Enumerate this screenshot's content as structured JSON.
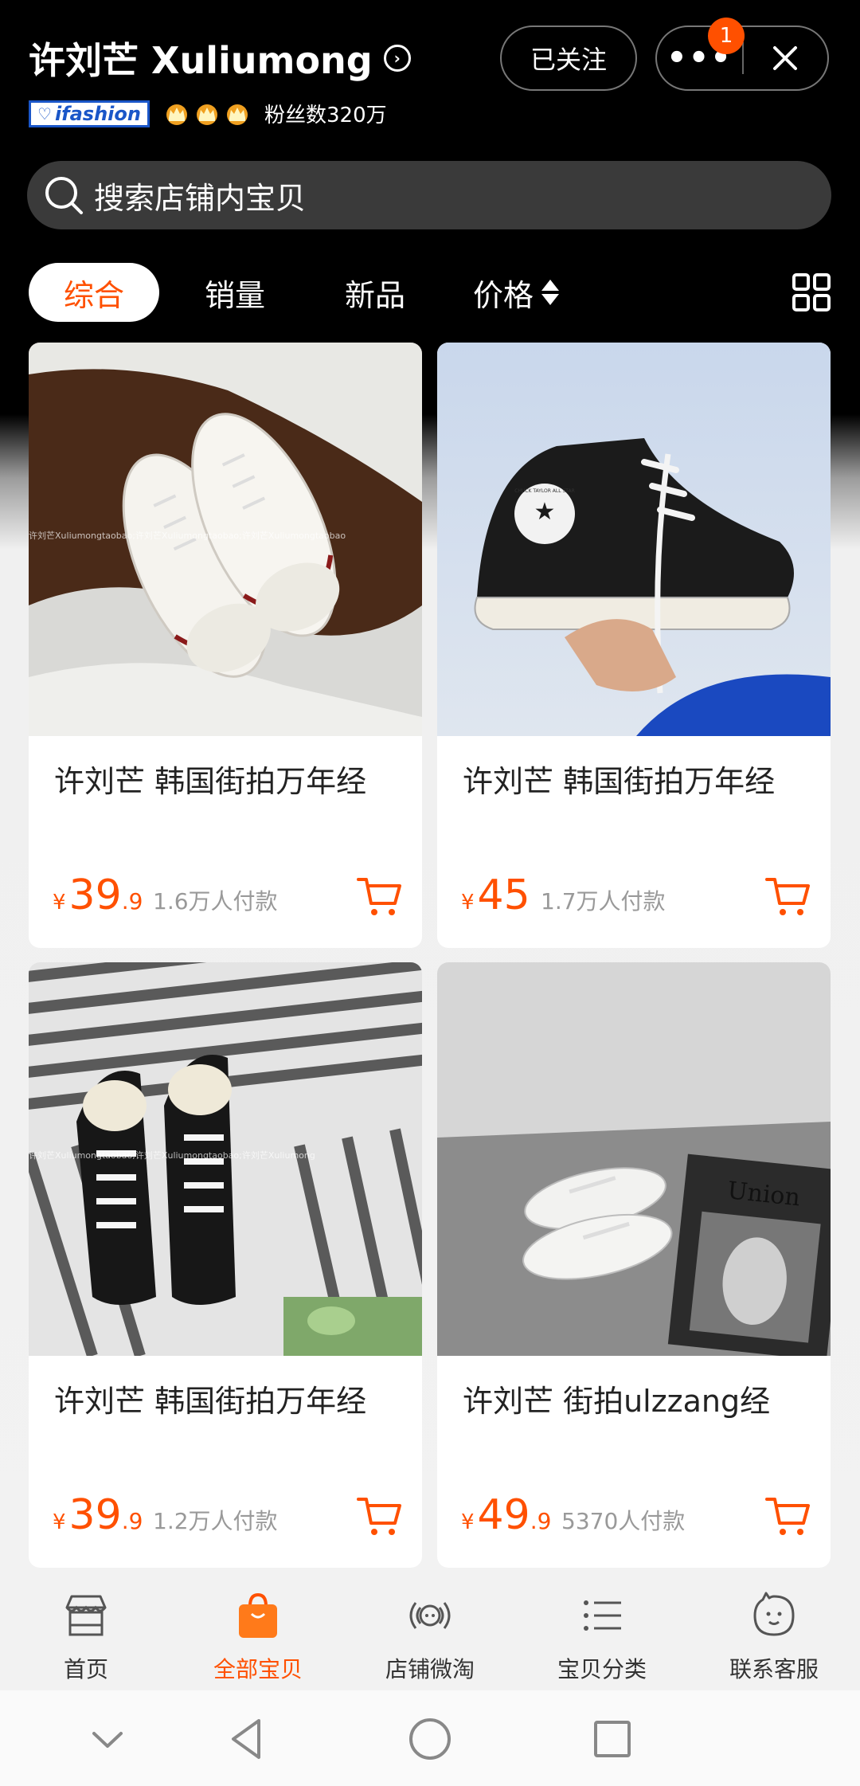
{
  "header": {
    "store_name": "许刘芒 Xuliumong",
    "info_symbol": "›",
    "brand_badge": "ifashion",
    "fans": "粉丝数320万",
    "follow_label": "已关注",
    "notification_count": "1",
    "more_glyph": "•••"
  },
  "search": {
    "placeholder": "搜索店铺内宝贝"
  },
  "tabs": [
    {
      "label": "综合"
    },
    {
      "label": "销量"
    },
    {
      "label": "新品"
    },
    {
      "label": "价格"
    }
  ],
  "products": [
    {
      "title": "许刘芒 韩国街拍万年经",
      "yen": "¥",
      "price_int": "39",
      "price_dec": ".9",
      "sold": "1.6万人付款",
      "watermark": "许刘芒Xuliumongtaobao;许刘芒Xuliumongtaobao;许刘芒Xuliumongtaobao"
    },
    {
      "title": "许刘芒 韩国街拍万年经",
      "yen": "¥",
      "price_int": "45",
      "price_dec": "",
      "sold": "1.7万人付款",
      "shoe_text": "CHUCK TAYLOR ALL STAR"
    },
    {
      "title": "许刘芒 韩国街拍万年经",
      "yen": "¥",
      "price_int": "39",
      "price_dec": ".9",
      "sold": "1.2万人付款",
      "watermark": "许刘芒Xuliumongtaobao;许刘芒Xuliumongtaobao;许刘芒Xuliumong"
    },
    {
      "title": "许刘芒 街拍ulzzang经",
      "yen": "¥",
      "price_int": "49",
      "price_dec": ".9",
      "sold": "5370人付款",
      "book_title": "Union"
    }
  ],
  "bottom_nav": [
    {
      "label": "首页",
      "icon": "storefront-icon"
    },
    {
      "label": "全部宝贝",
      "icon": "shopping-bag-icon"
    },
    {
      "label": "店铺微淘",
      "icon": "broadcast-icon"
    },
    {
      "label": "宝贝分类",
      "icon": "list-icon"
    },
    {
      "label": "联系客服",
      "icon": "chat-icon"
    }
  ],
  "colors": {
    "accent": "#ff5000",
    "header_bg": "#000000",
    "card_bg": "#ffffff"
  }
}
